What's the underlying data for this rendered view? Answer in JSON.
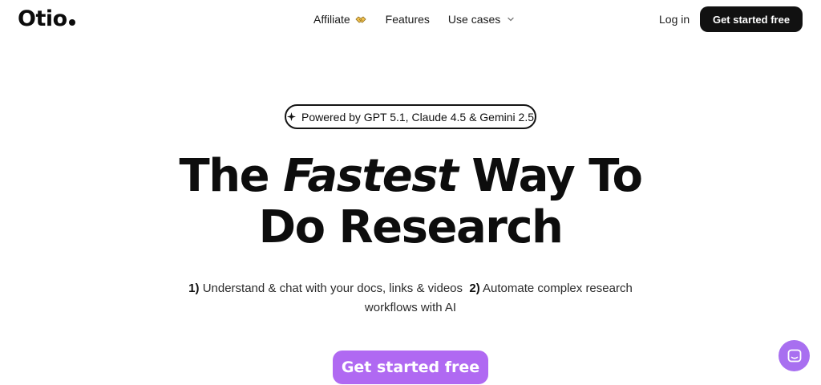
{
  "brand": {
    "logo_text": "Otio"
  },
  "nav": {
    "items": [
      {
        "label": "Affiliate",
        "icon": "handshake-icon"
      },
      {
        "label": "Features"
      },
      {
        "label": "Use cases",
        "icon": "chevron-down-icon"
      }
    ],
    "login_label": "Log in",
    "cta_label": "Get started free"
  },
  "hero": {
    "badge": "Powered by GPT 5.1, Claude 4.5 & Gemini 2.5",
    "headline": {
      "part1": "The",
      "emphasis": "Fastest",
      "part2": "Way To",
      "line2": "Do Research"
    },
    "subtext": {
      "num1": "1)",
      "text1": "Understand & chat with your docs, links & videos",
      "num2": "2)",
      "text2": "Automate complex research workflows with AI"
    },
    "cta_label": "Get started free"
  },
  "chat_widget": {
    "icon": "chat-icon"
  },
  "colors": {
    "primary_dark": "#111111",
    "accent_purple": "#b069f2",
    "chat_purple": "#a86ff0",
    "background": "#ffffff"
  }
}
